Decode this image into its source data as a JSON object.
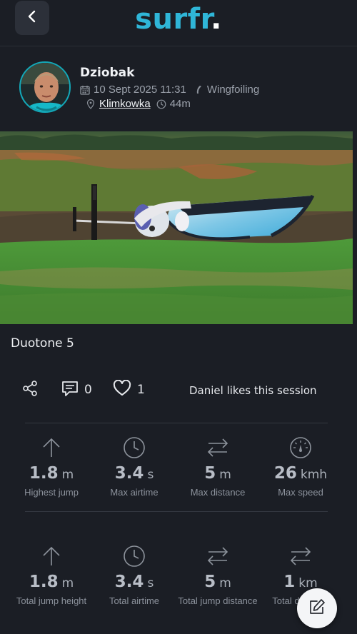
{
  "header": {
    "logo_text": "surfr",
    "logo_dot": ".",
    "back_icon": "chevron-left-icon",
    "colors": {
      "brand": "#2fb6d8",
      "background": "#1b1e25"
    }
  },
  "profile": {
    "user_name": "Dziobak",
    "date": "10 Sept 2025 11:31",
    "sport": "Wingfoiling",
    "spot": "Klimkowka",
    "duration": "44m"
  },
  "session": {
    "title": "Duotone 5",
    "comments_count": "0",
    "likes_count": "1",
    "likes_text": "Daniel likes this session"
  },
  "stats_primary": [
    {
      "icon": "arrow-up-icon",
      "value": "1.8",
      "unit": "m",
      "label": "Highest jump"
    },
    {
      "icon": "clock-icon",
      "value": "3.4",
      "unit": "s",
      "label": "Max airtime"
    },
    {
      "icon": "swap-arrows-icon",
      "value": "5",
      "unit": "m",
      "label": "Max distance"
    },
    {
      "icon": "speedometer-icon",
      "value": "26",
      "unit": "kmh",
      "label": "Max speed"
    }
  ],
  "stats_total": [
    {
      "icon": "arrow-up-icon",
      "value": "1.8",
      "unit": "m",
      "label": "Total jump height"
    },
    {
      "icon": "clock-icon",
      "value": "3.4",
      "unit": "s",
      "label": "Total airtime"
    },
    {
      "icon": "swap-arrows-icon",
      "value": "5",
      "unit": "m",
      "label": "Total jump distance"
    },
    {
      "icon": "swap-arrows-icon",
      "value": "1",
      "unit": "km",
      "label": "Total distance"
    }
  ],
  "fab": {
    "icon": "edit-icon"
  }
}
